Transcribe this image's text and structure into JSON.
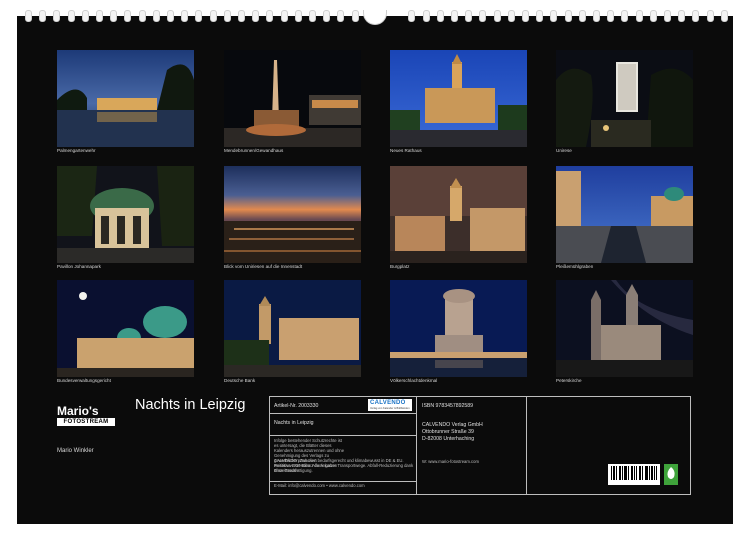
{
  "photos": [
    {
      "caption": "Palmengartenwehr"
    },
    {
      "caption": "Mendebrunnen/Gewandhaus"
    },
    {
      "caption": "Neues Rathaus"
    },
    {
      "caption": "Unirese"
    },
    {
      "caption": "Pavillon Johannapark"
    },
    {
      "caption": "Blick vom Uniriesen auf die Innenstadt"
    },
    {
      "caption": "Burgplatz"
    },
    {
      "caption": "Pleißemühlgraben"
    },
    {
      "caption": "Bundesverwaltungsgericht"
    },
    {
      "caption": "Deutsche Bank"
    },
    {
      "caption": "Völkerschlachtdenkmal"
    },
    {
      "caption": "Peterskirche"
    }
  ],
  "logo": {
    "title": "Mario's",
    "subtitle": "FOTOSTREAM"
  },
  "author": "Mario Winkler",
  "calendar_title": "Nachts in Leipzig",
  "info": {
    "article_label": "Artikel-Nr. 2003330",
    "calvendo": "CALVENDO",
    "calvendo_sub": "Verlag von Kalender & Bildbänden",
    "isbn": "ISBN 9783457892589",
    "title_line": "Nachts in Leipzig",
    "legal": "Infolge bestehender Schutzrechte ist es untersagt, die Blätter dieses Kalenders herauszutrennen und ohne Genehmigung des Verlags zu gewerblichen Zwecken weiterzuverwenden. Alle Angaben ohne Gewähr.",
    "green": "CALVENDO produziert bedarfsgerecht und klimabewusst in DE & EU. Posititive CO2-Bilanz dank kurzer Transportwege. Abfall-Reduzierung dank Einzelstückfertigung.",
    "email": "E-Mail: info@calvendo.com • www.calvendo.com",
    "publisher_name": "CALVENDO Verlag GmbH",
    "publisher_street": "Ottobrunner Straße 39",
    "publisher_city": "D-82008 Unterhaching",
    "url": "W: www.mario-fotostream.com"
  },
  "colors": {
    "background": "#0b0b0b",
    "text": "#d8d8d8",
    "calvendo_blue": "#1a73c5",
    "leaf_green": "#3fa33b"
  }
}
